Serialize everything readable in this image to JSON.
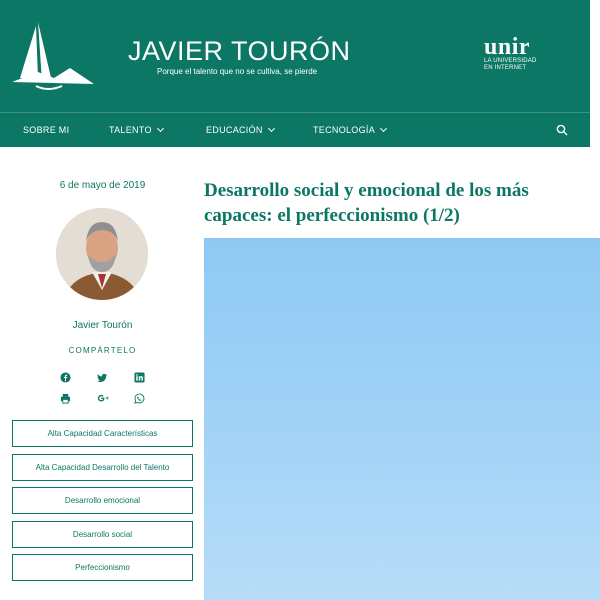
{
  "site": {
    "title": "JAVIER TOURÓN",
    "tagline": "Porque el talento que no se cultiva, se pierde",
    "partner": {
      "name": "unir",
      "sub_line1": "LA UNIVERSIDAD",
      "sub_line2": "EN INTERNET"
    }
  },
  "nav": {
    "items": [
      {
        "label": "SOBRE MI",
        "has_dropdown": false
      },
      {
        "label": "TALENTO",
        "has_dropdown": true
      },
      {
        "label": "EDUCACIÓN",
        "has_dropdown": true
      },
      {
        "label": "TECNOLOGÍA",
        "has_dropdown": true
      }
    ],
    "search_icon": "search-icon"
  },
  "post": {
    "date": "6 de mayo de 2019",
    "author": "Javier Tourón",
    "share_label": "COMPÁRTELO",
    "share_icons": [
      "facebook-icon",
      "twitter-icon",
      "linkedin-icon",
      "print-icon",
      "google-plus-icon",
      "whatsapp-icon"
    ],
    "title": "Desarrollo social y emocional de los más capaces: el perfeccionismo (1/2)",
    "tags": [
      "Alta Capacidad Características",
      "Alta Capacidad Desarrollo del Talento",
      "Desarrollo emocional",
      "Desarrollo social",
      "Perfeccionismo"
    ]
  },
  "colors": {
    "brand": "#0c7764",
    "sky": "#9fd1f6"
  }
}
